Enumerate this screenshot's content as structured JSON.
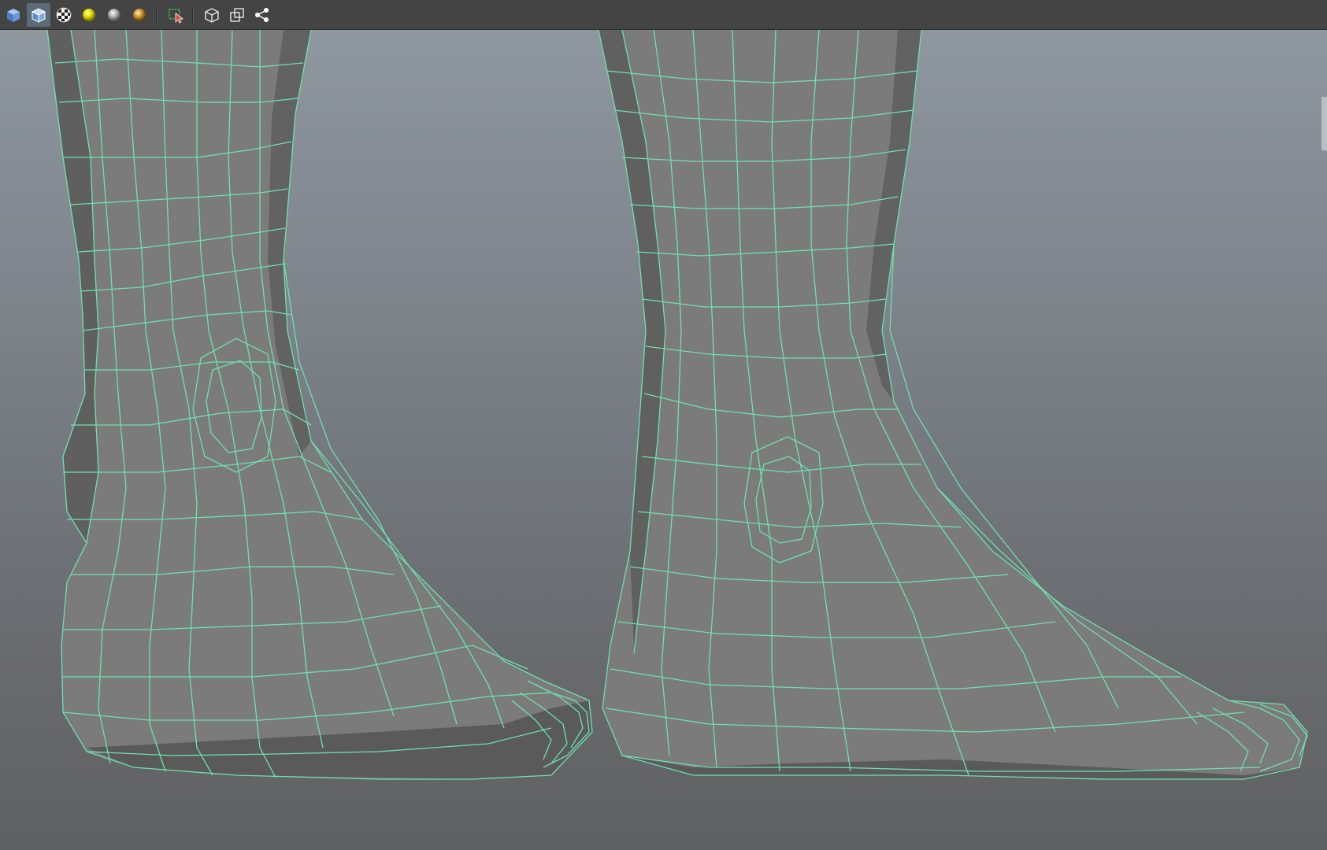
{
  "toolbar": {
    "buttons": [
      {
        "id": "shaded",
        "icon": "shaded-cube-icon"
      },
      {
        "id": "wireframe-on-shaded",
        "icon": "wire-cube-icon"
      },
      {
        "id": "textured",
        "icon": "checker-icon"
      },
      {
        "id": "use-all-lights",
        "icon": "yellow-light-sphere-icon"
      },
      {
        "id": "shadows",
        "icon": "grey-sphere-icon"
      },
      {
        "id": "default-material",
        "icon": "gold-sphere-icon"
      },
      {
        "id": "isolate-select",
        "icon": "isolate-select-icon"
      },
      {
        "id": "xray",
        "icon": "outline-cube-icon"
      },
      {
        "id": "xray-joints",
        "icon": "overlap-squares-icon"
      },
      {
        "id": "xray-components",
        "icon": "graph-nodes-icon"
      }
    ]
  },
  "viewport": {
    "wire_color": "#6fe0b0",
    "mesh_fill": "#7b7b7b",
    "mesh_shadow": "#5f5f5f"
  }
}
